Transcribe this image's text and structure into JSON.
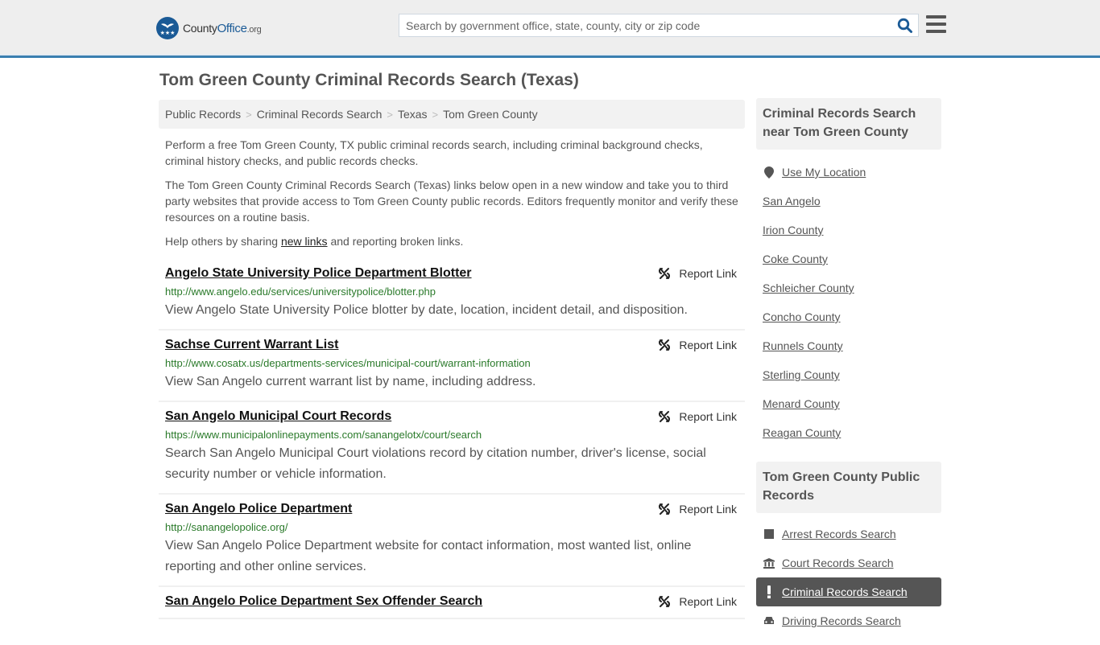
{
  "header": {
    "logo": {
      "brand_prefix": "County",
      "brand_main": "Office",
      "brand_suffix": ".org"
    },
    "search": {
      "placeholder": "Search by government office, state, county, city or zip code",
      "value": ""
    },
    "icons": {
      "search": "search-icon",
      "menu": "hamburger-menu-icon"
    }
  },
  "page": {
    "title": "Tom Green County Criminal Records Search (Texas)",
    "breadcrumb": [
      "Public Records",
      "Criminal Records Search",
      "Texas",
      "Tom Green County"
    ],
    "intro": {
      "p1": "Perform a free Tom Green County, TX public criminal records search, including criminal background checks, criminal history checks, and public records checks.",
      "p2": "The Tom Green County Criminal Records Search (Texas) links below open in a new window and take you to third party websites that provide access to Tom Green County public records. Editors frequently monitor and verify these resources on a routine basis.",
      "p3_before": "Help others by sharing ",
      "p3_link": "new links",
      "p3_after": " and reporting broken links."
    }
  },
  "results": [
    {
      "title": "Angelo State University Police Department Blotter",
      "url": "http://www.angelo.edu/services/universitypolice/blotter.php",
      "description": "View Angelo State University Police blotter by date, location, incident detail, and disposition.",
      "report_label": "Report Link"
    },
    {
      "title": "Sachse Current Warrant List",
      "url": "http://www.cosatx.us/departments-services/municipal-court/warrant-information",
      "description": "View San Angelo current warrant list by name, including address.",
      "report_label": "Report Link"
    },
    {
      "title": "San Angelo Municipal Court Records",
      "url": "https://www.municipalonlinepayments.com/sanangelotx/court/search",
      "description": "Search San Angelo Municipal Court violations record by citation number, driver's license, social security number or vehicle information.",
      "report_label": "Report Link"
    },
    {
      "title": "San Angelo Police Department",
      "url": "http://sanangelopolice.org/",
      "description": "View San Angelo Police Department website for contact information, most wanted list, online reporting and other online services.",
      "report_label": "Report Link"
    },
    {
      "title": "San Angelo Police Department Sex Offender Search",
      "url": "",
      "description": "",
      "report_label": "Report Link"
    }
  ],
  "sidebar": {
    "nearby": {
      "heading": "Criminal Records Search near Tom Green County",
      "use_location": "Use My Location",
      "items": [
        "San Angelo",
        "Irion County",
        "Coke County",
        "Schleicher County",
        "Concho County",
        "Runnels County",
        "Sterling County",
        "Menard County",
        "Reagan County"
      ]
    },
    "public_records": {
      "heading": "Tom Green County Public Records",
      "items": [
        {
          "label": "Arrest Records Search",
          "icon": "square-icon",
          "active": false
        },
        {
          "label": "Court Records Search",
          "icon": "courthouse-icon",
          "active": false
        },
        {
          "label": "Criminal Records Search",
          "icon": "exclamation-icon",
          "active": true
        },
        {
          "label": "Driving Records Search",
          "icon": "car-icon",
          "active": false
        }
      ]
    }
  },
  "colors": {
    "brand_blue": "#1a5a96",
    "header_border": "#3a7fb0",
    "url_green": "#2a7a2a",
    "active_bg": "#555555"
  }
}
